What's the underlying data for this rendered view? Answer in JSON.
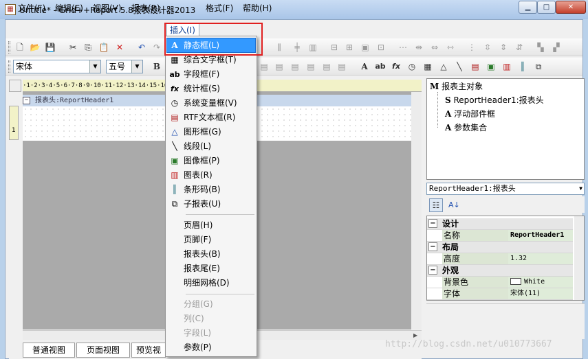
{
  "window": {
    "title": "Untitle* - Grid++Report 5.8报表设计器2013"
  },
  "menubar": {
    "items": [
      "文件(F)",
      "编辑(E)",
      "视图(V)",
      "报表(R)",
      "插入(I)",
      "格式(F)",
      "帮助(H)"
    ]
  },
  "toolbar2": {
    "font_name": "宋体",
    "font_size": "五号",
    "bold": "B"
  },
  "ruler": {
    "text": "·1·2·3·4·5·6·7·8·9·10·11·12·13·14·15·16·17"
  },
  "design": {
    "section_title": "报表头:ReportHeader1",
    "vruler_label": "1"
  },
  "tabs": [
    "普通视图",
    "页面视图",
    "预览视"
  ],
  "tree": {
    "root": "报表主对象",
    "items": [
      "ReportHeader1:报表头",
      "浮动部件框",
      "参数集合"
    ],
    "root_icon": "M",
    "icons": [
      "S",
      "A",
      "A"
    ]
  },
  "object_selector": "ReportHeader1:报表头",
  "props": {
    "design_cat": "设计",
    "name_label": "名称",
    "name_value": "ReportHeader1",
    "layout_cat": "布局",
    "height_label": "高度",
    "height_value": "1.32",
    "appearance_cat": "外观",
    "bg_label": "背景色",
    "bg_value": "White",
    "font_label": "字体",
    "font_value": "宋体(11)"
  },
  "insert_menu": {
    "items": [
      {
        "label": "静态框(L)",
        "icon": "A"
      },
      {
        "label": "综合文字框(T)",
        "icon": "▦"
      },
      {
        "label": "字段框(F)",
        "icon": "ab"
      },
      {
        "label": "统计框(S)",
        "icon": "fx"
      },
      {
        "label": "系统变量框(V)",
        "icon": "◷"
      },
      {
        "label": "RTF文本框(R)",
        "icon": "▤"
      },
      {
        "label": "图形框(G)",
        "icon": "△"
      },
      {
        "label": "线段(L)",
        "icon": "╲"
      },
      {
        "label": "图像框(P)",
        "icon": "▣"
      },
      {
        "label": "图表(R)",
        "icon": "▥"
      },
      {
        "label": "条形码(B)",
        "icon": "║"
      },
      {
        "label": "子报表(U)",
        "icon": "⧉"
      }
    ],
    "section_items": [
      "页眉(H)",
      "页脚(F)",
      "报表头(B)",
      "报表尾(E)",
      "明细网格(D)"
    ],
    "disabled_items": [
      "分组(G)",
      "列(C)",
      "字段(L)"
    ],
    "param_item": "参数(P)"
  },
  "watermark": "http://blog.csdn.net/u010773667"
}
